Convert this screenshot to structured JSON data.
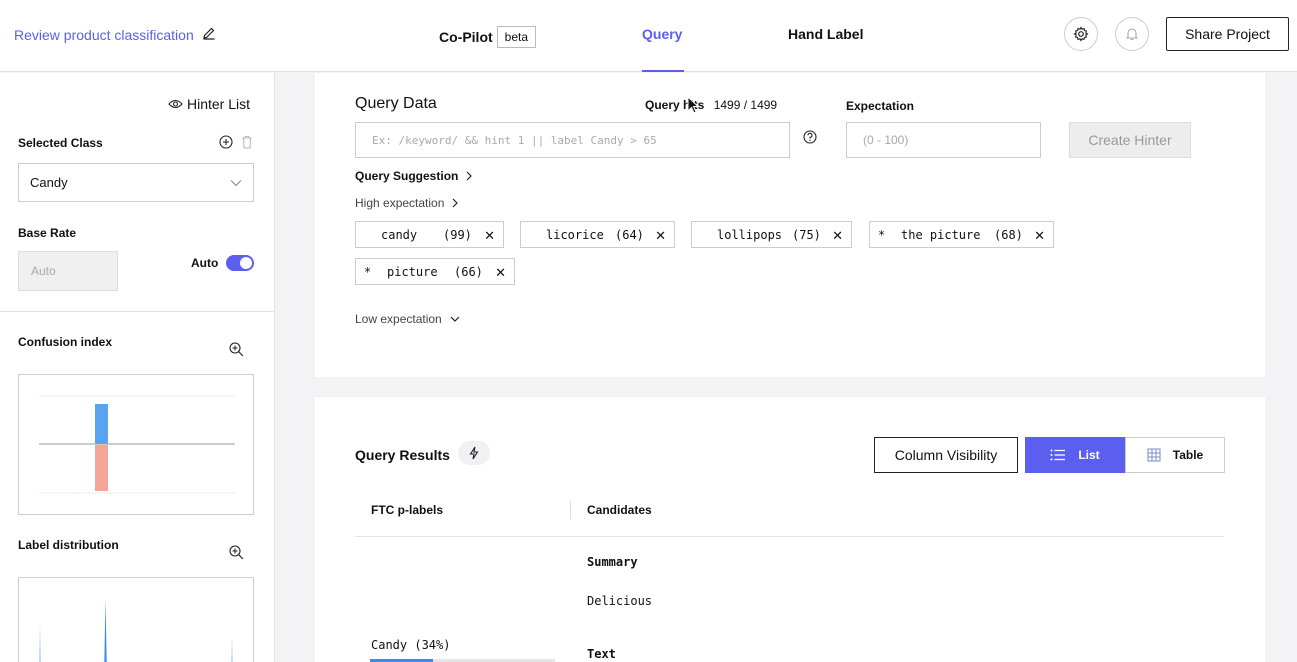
{
  "header": {
    "project_title": "Review product classification",
    "copilot_label": "Co-Pilot",
    "beta_badge": "beta",
    "tabs": [
      {
        "label": "Query",
        "active": true
      },
      {
        "label": "Hand Label",
        "active": false
      }
    ],
    "share_label": "Share Project",
    "accent_color": "#5b5ff0"
  },
  "sidebar": {
    "hinter_list_label": "Hinter List",
    "selected_class_label": "Selected Class",
    "selected_class_value": "Candy",
    "base_rate_label": "Base Rate",
    "base_rate_placeholder": "Auto",
    "auto_label": "Auto",
    "auto_enabled": true,
    "confusion_index_label": "Confusion index",
    "label_distribution_label": "Label distribution"
  },
  "query_data": {
    "title": "Query Data",
    "query_hits_label": "Query hits",
    "query_hits_value": "1499 / 1499",
    "expectation_label": "Expectation",
    "query_placeholder": "Ex: /keyword/ && hint 1 || label Candy > 65",
    "expectation_placeholder": "(0 - 100)",
    "create_hinter_label": "Create Hinter",
    "query_suggestion_label": "Query Suggestion",
    "high_expectation_label": "High expectation",
    "low_expectation_label": "Low expectation",
    "high_chips": [
      {
        "star": "",
        "word": "candy",
        "score": "(99)"
      },
      {
        "star": "",
        "word": "licorice",
        "score": "(64)"
      },
      {
        "star": "",
        "word": "lollipops",
        "score": "(75)"
      },
      {
        "star": "*",
        "word": "the picture",
        "score": "(68)"
      },
      {
        "star": "*",
        "word": "picture",
        "score": "(66)"
      }
    ]
  },
  "query_results": {
    "title": "Query Results",
    "column_visibility_label": "Column Visibility",
    "list_label": "List",
    "table_label": "Table",
    "columns": [
      "FTC p-labels",
      "Candidates"
    ],
    "rows": [
      {
        "plabel": "Candy (34%)",
        "plabel_fraction": 0.34,
        "summary_label": "Summary",
        "summary_value": "Delicious",
        "text_label": "Text"
      }
    ]
  }
}
